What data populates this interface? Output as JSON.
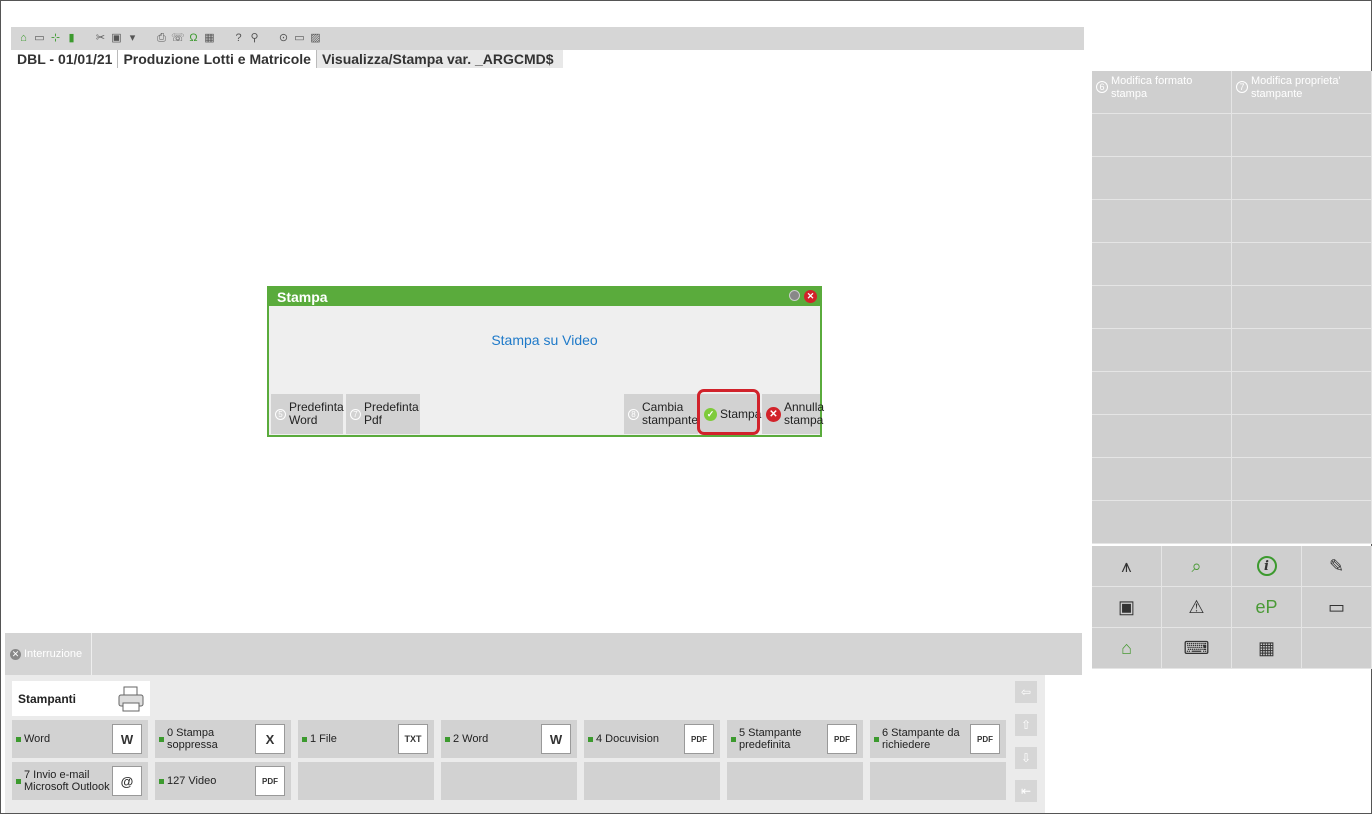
{
  "toolbar": {
    "groups": [
      [
        "home-icon",
        "new-doc-icon",
        "tree-icon",
        "book-icon"
      ],
      [
        "scissors-icon",
        "screen-icon",
        "filter-icon"
      ],
      [
        "printer-icon",
        "phone-icon",
        "omega-icon",
        "calculator-icon"
      ],
      [
        "help-icon",
        "search-user-icon"
      ],
      [
        "record-icon",
        "monitor-icon",
        "image-icon"
      ]
    ]
  },
  "breadcrumb": [
    "DBL - 01/01/21",
    "Produzione Lotti e Matricole",
    "Visualizza/Stampa var. _ARGCMD$"
  ],
  "right_panel": {
    "function_keys": [
      {
        "key": "6",
        "label": "Modifica formato stampa"
      },
      {
        "key": "7",
        "label": "Modifica proprieta' stampante"
      }
    ],
    "empty_rows": 10
  },
  "interrupt": {
    "label": "Interruzione"
  },
  "printers": {
    "tab_label": "Stampanti",
    "items": [
      {
        "label": "Word",
        "icon": "W"
      },
      {
        "label": "0 Stampa soppressa",
        "icon": "X"
      },
      {
        "label": "1 File",
        "icon": "TXT"
      },
      {
        "label": "2 Word",
        "icon": "W"
      },
      {
        "label": "4 Docuvision",
        "icon": "PDF"
      },
      {
        "label": "5 Stampante predefinita",
        "icon": "PDF"
      },
      {
        "label": "6 Stampante da richiedere",
        "icon": "PDF"
      },
      {
        "label": "7 Invio e-mail Microsoft Outlook",
        "icon": "@"
      },
      {
        "label": "127 Video",
        "icon": "PDF"
      }
    ]
  },
  "dialog": {
    "title": "Stampa",
    "message": "Stampa su Video",
    "buttons": [
      {
        "key": "5",
        "label": "Predefinta Word"
      },
      {
        "key": "7",
        "label": "Predefinta Pdf"
      },
      {
        "key": "8",
        "label": "Cambia stampante"
      },
      {
        "key": "",
        "label": "Stampa"
      },
      {
        "key": "",
        "label": "Annulla stampa"
      }
    ]
  },
  "colors": {
    "accent_green": "#5aab3c",
    "highlight_red": "#d1222b",
    "message_blue": "#1f7ac9"
  }
}
